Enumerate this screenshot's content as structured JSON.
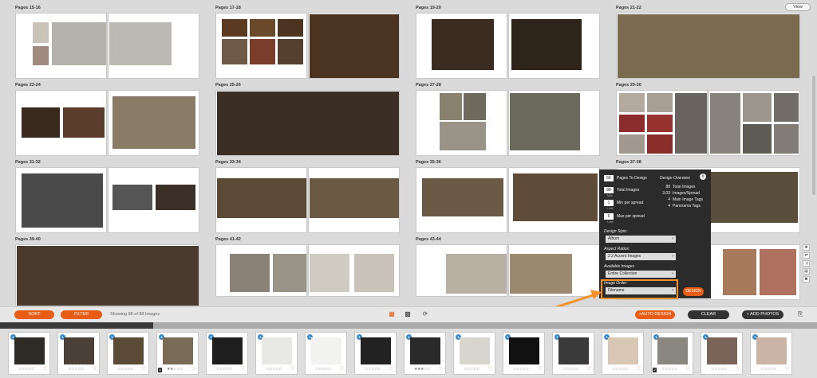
{
  "header": {
    "view_label": "View"
  },
  "spreads": [
    {
      "label": "Pages 15-16"
    },
    {
      "label": "Pages 17-18"
    },
    {
      "label": "Pages 19-20"
    },
    {
      "label": "Pages 21-22"
    },
    {
      "label": "Pages 23-24"
    },
    {
      "label": "Pages 25-26"
    },
    {
      "label": "Pages 27-28"
    },
    {
      "label": "Pages 29-30"
    },
    {
      "label": "Pages 31-32"
    },
    {
      "label": "Pages 33-34"
    },
    {
      "label": "Pages 35-36"
    },
    {
      "label": "Pages 37-38"
    },
    {
      "label": "Pages 39-40"
    },
    {
      "label": "Pages 41-42"
    },
    {
      "label": "Pages 43-44"
    }
  ],
  "design_panel": {
    "pages_to_design": {
      "value": "56",
      "label": "Pages To Design"
    },
    "total_images": {
      "value": "88",
      "label": "Total Images",
      "sub": "Max"
    },
    "min_per_spread": {
      "value": "1",
      "label": "Min per spread",
      "sub": "Limit"
    },
    "max_per_spread": {
      "value": "6",
      "label": "Max per spread",
      "sub": "Limit"
    },
    "overview": {
      "title": "Design Overview",
      "rows": [
        {
          "value": "88",
          "label": "Total Images"
        },
        {
          "value": "3.03",
          "label": "Images/Spread"
        },
        {
          "value": "4",
          "label": "Main Image Tags"
        },
        {
          "value": "4",
          "label": "Panorama Tags"
        }
      ]
    },
    "design_style": {
      "label": "Design Style:",
      "value": "Album"
    },
    "aspect_ratios": {
      "label": "Aspect Ratios:",
      "value": "2:2 Accent Images"
    },
    "available_images": {
      "label": "Available Images",
      "value": "Entire Collection"
    },
    "image_order": {
      "label": "Image Order:",
      "value": "Filename"
    },
    "design_button": "DESIGN"
  },
  "toolbar": {
    "sort_label": "SORT",
    "filter_label": "FILTER",
    "showing": "Showing 88 of 88 Images",
    "auto_design_label": "+AUTO DESIGN",
    "clear_label": "CLEAR",
    "add_photos_label": "+ ADD PHOTOS"
  },
  "thumbnails": [
    {
      "count": "",
      "stars": "☆☆☆☆☆"
    },
    {
      "count": "",
      "stars": "☆☆☆☆☆"
    },
    {
      "count": "",
      "stars": "☆☆☆☆☆"
    },
    {
      "count": "1",
      "stars": "★★☆☆☆"
    },
    {
      "count": "",
      "stars": "☆☆☆☆☆"
    },
    {
      "count": "",
      "stars": "☆☆☆☆☆"
    },
    {
      "count": "",
      "stars": "☆☆☆☆☆"
    },
    {
      "count": "",
      "stars": "☆☆☆☆☆"
    },
    {
      "count": "",
      "stars": "★★★☆☆"
    },
    {
      "count": "",
      "stars": "☆☆☆☆☆"
    },
    {
      "count": "",
      "stars": "☆☆☆☆☆"
    },
    {
      "count": "",
      "stars": "☆☆☆☆☆"
    },
    {
      "count": "",
      "stars": "☆☆☆☆☆"
    },
    {
      "count": "2",
      "stars": "☆☆☆☆☆"
    },
    {
      "count": "",
      "stars": "☆☆☆☆☆"
    },
    {
      "count": "",
      "stars": "☆☆☆☆☆"
    }
  ],
  "colors": {
    "accent": "#e85d16",
    "panel": "#2b2b2b",
    "highlight": "#f39026",
    "badge": "#3d8ac8"
  }
}
